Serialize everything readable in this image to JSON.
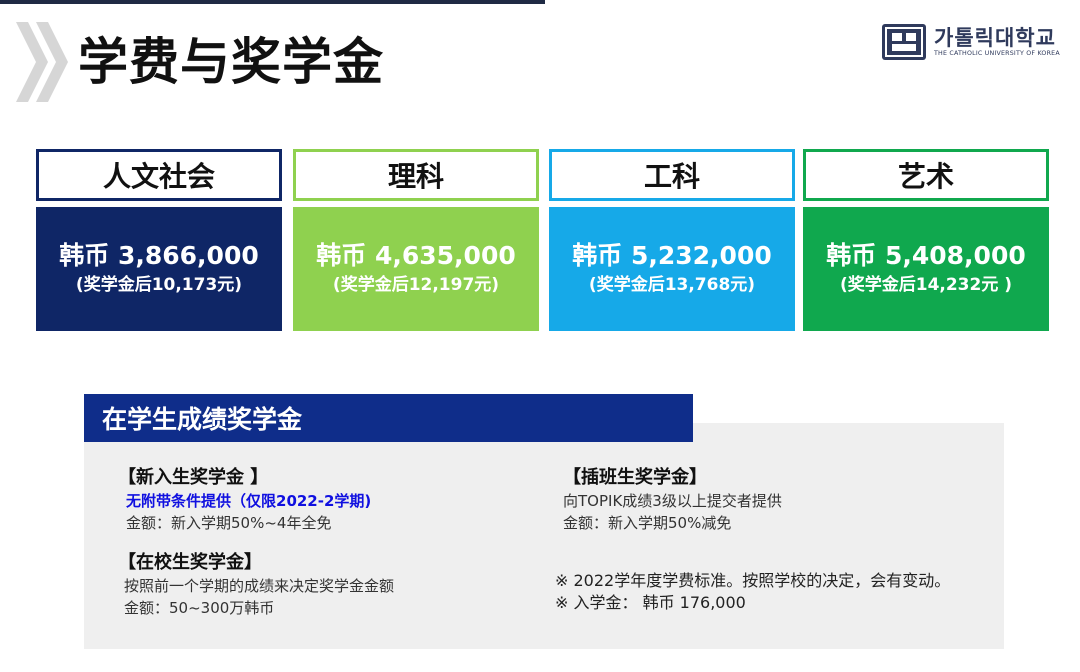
{
  "header": {
    "title": "学费与奖学金",
    "logo": {
      "korean": "가톨릭대학교",
      "english": "THE CATHOLIC UNIVERSITY OF KOREA"
    }
  },
  "tuition": [
    {
      "category": "人文社会",
      "price": "韩币 3,866,000",
      "note": "(奖学金后10,173元)",
      "border_color": "#0f2666",
      "fill_color": "#0f2666"
    },
    {
      "category": "理科",
      "price": "韩币 4,635,000",
      "note": "(奖学金后12,197元)",
      "border_color": "#8fd14f",
      "fill_color": "#8fd14f"
    },
    {
      "category": "工科",
      "price": "韩币 5,232,000",
      "note": "(奖学金后13,768元)",
      "border_color": "#16a9e8",
      "fill_color": "#16a9e8"
    },
    {
      "category": "艺术",
      "price": "韩币 5,408,000",
      "note": "(奖学金后14,232元 )",
      "border_color": "#10a84e",
      "fill_color": "#10a84e"
    }
  ],
  "scholarship": {
    "heading": "在学生成绩奖学金",
    "new_student": {
      "title": "【新入生奖学金 】",
      "condition": "无附带条件提供（仅限2022-2学期)",
      "amount": "金额：新入学期50%~4年全免"
    },
    "current_student": {
      "title": "【在校生奖学金】",
      "desc": "按照前一个学期的成绩来决定奖学金金额",
      "amount": "金额：50~300万韩币"
    },
    "transfer_student": {
      "title": "【插班生奖学金】",
      "desc": "向TOPIK成绩3级以上提交者提供",
      "amount": "金额：新入学期50%减免"
    },
    "notes": [
      "※ 2022学年度学费标准。按照学校的决定，会有变动。",
      "※ 入学金：  韩币 176,000"
    ]
  }
}
